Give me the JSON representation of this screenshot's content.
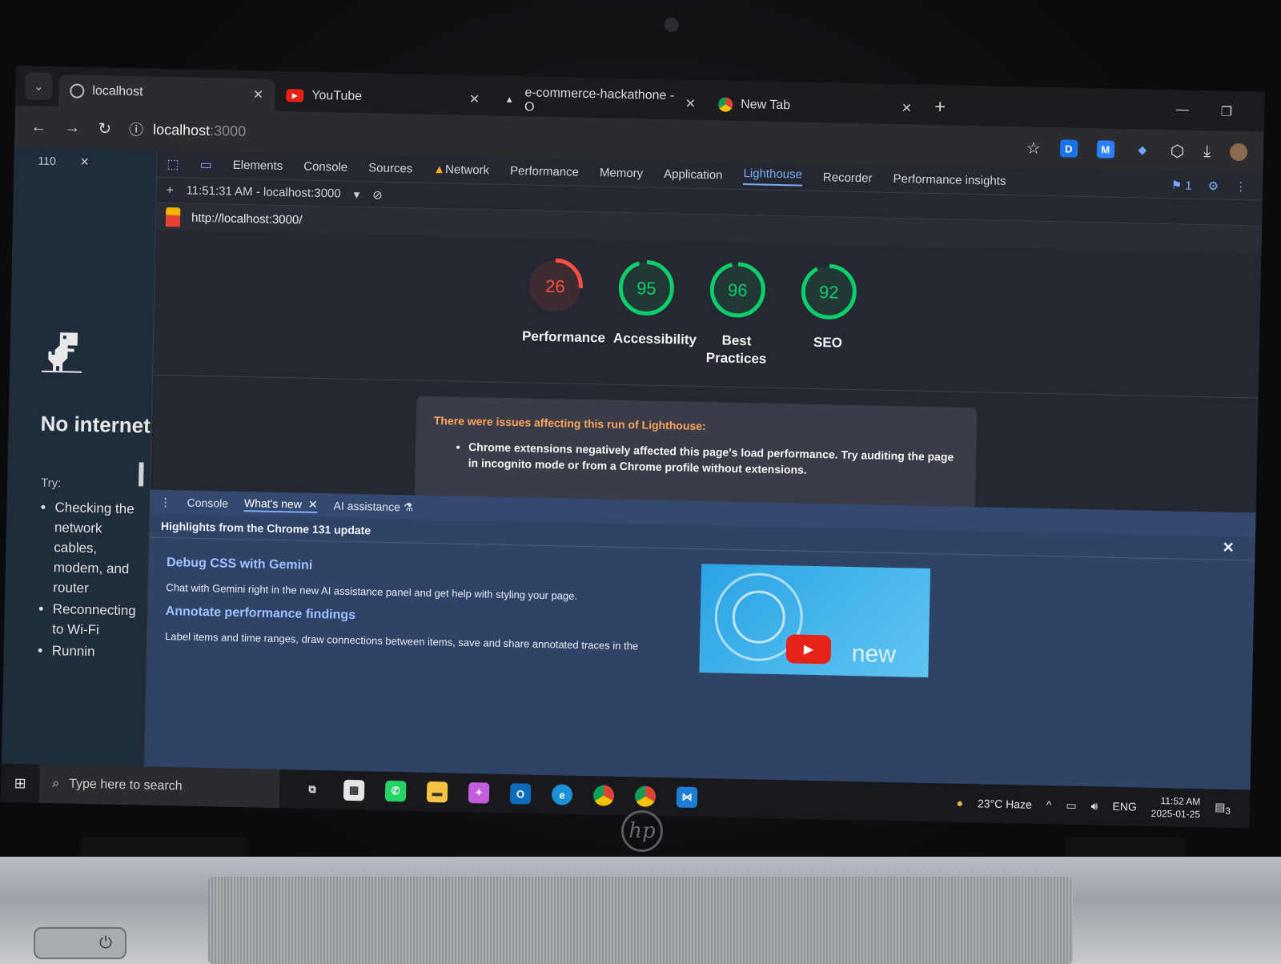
{
  "browser": {
    "tabs": [
      {
        "title": "localhost",
        "icon": "globe-icon",
        "active": true
      },
      {
        "title": "YouTube",
        "icon": "youtube-icon",
        "active": false
      },
      {
        "title": "e-commerce-hackathone - O",
        "icon": "warning-icon",
        "active": false
      },
      {
        "title": "New Tab",
        "icon": "chrome-icon",
        "active": false
      }
    ],
    "address": {
      "host": "localhost",
      "port": ":3000"
    }
  },
  "offline_page": {
    "zoom": "110",
    "heading": "No internet",
    "try_label": "Try:",
    "tips": [
      "Checking the network cables, modem, and router",
      "Reconnecting to Wi-Fi",
      "Runnin"
    ]
  },
  "devtools": {
    "tabs": [
      "Elements",
      "Console",
      "Sources",
      "Network",
      "Performance",
      "Memory",
      "Application",
      "Lighthouse",
      "Recorder",
      "Performance insights"
    ],
    "active_tab": "Lighthouse",
    "issues_badge": "1",
    "report_time": "11:51:31 AM - localhost:3000",
    "report_url": "http://localhost:3000/",
    "scores": [
      {
        "label": "Performance",
        "value": 26,
        "color": "#ff4e42"
      },
      {
        "label": "Accessibility",
        "value": 95,
        "color": "#0cce6b"
      },
      {
        "label": "Best Practices",
        "value": 96,
        "color": "#0cce6b"
      },
      {
        "label": "SEO",
        "value": 92,
        "color": "#0cce6b"
      }
    ],
    "warning": {
      "title": "There were issues affecting this run of Lighthouse:",
      "items": [
        "Chrome extensions negatively affected this page's load performance. Try auditing the page in incognito mode or from a Chrome profile without extensions."
      ]
    },
    "drawer": {
      "tabs": [
        "Console",
        "What's new",
        "AI assistance"
      ],
      "active_tab": "What's new",
      "highlights": "Highlights from the Chrome 131 update",
      "articles": [
        {
          "title": "Debug CSS with Gemini",
          "text": "Chat with Gemini right in the new AI assistance panel and get help with styling your page."
        },
        {
          "title": "Annotate performance findings",
          "text": "Label items and time ranges, draw connections between items, save and share annotated traces in the"
        }
      ],
      "promo_text": "new"
    }
  },
  "taskbar": {
    "search_placeholder": "Type here to search",
    "weather": "23°C  Haze",
    "language": "ENG",
    "time": "11:52 AM",
    "date": "2025-01-25",
    "notifications": "3"
  }
}
